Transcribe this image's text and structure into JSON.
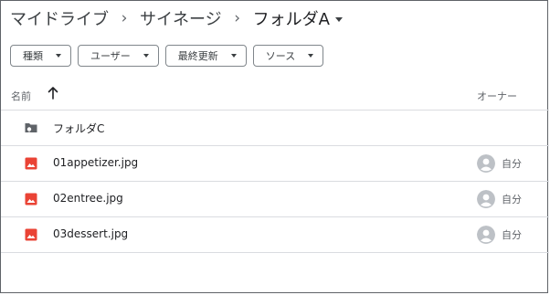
{
  "breadcrumb": {
    "items": [
      "マイドライブ",
      "サイネージ"
    ],
    "separator": "›",
    "current": "フォルダA"
  },
  "filters": [
    {
      "label": "種類"
    },
    {
      "label": "ユーザー"
    },
    {
      "label": "最終更新"
    },
    {
      "label": "ソース"
    }
  ],
  "table": {
    "columns": {
      "name": "名前",
      "owner": "オーナー"
    },
    "sort": "ascending",
    "rows": [
      {
        "type": "shared-folder",
        "name": "フォルダC",
        "owner": ""
      },
      {
        "type": "image",
        "name": "01appetizer.jpg",
        "owner": "自分"
      },
      {
        "type": "image",
        "name": "02entree.jpg",
        "owner": "自分"
      },
      {
        "type": "image",
        "name": "03dessert.jpg",
        "owner": "自分"
      }
    ]
  },
  "colors": {
    "image_icon": "#ea4335",
    "folder_icon": "#5f6368",
    "avatar": "#bdc1c6",
    "divider": "#dadce0"
  }
}
